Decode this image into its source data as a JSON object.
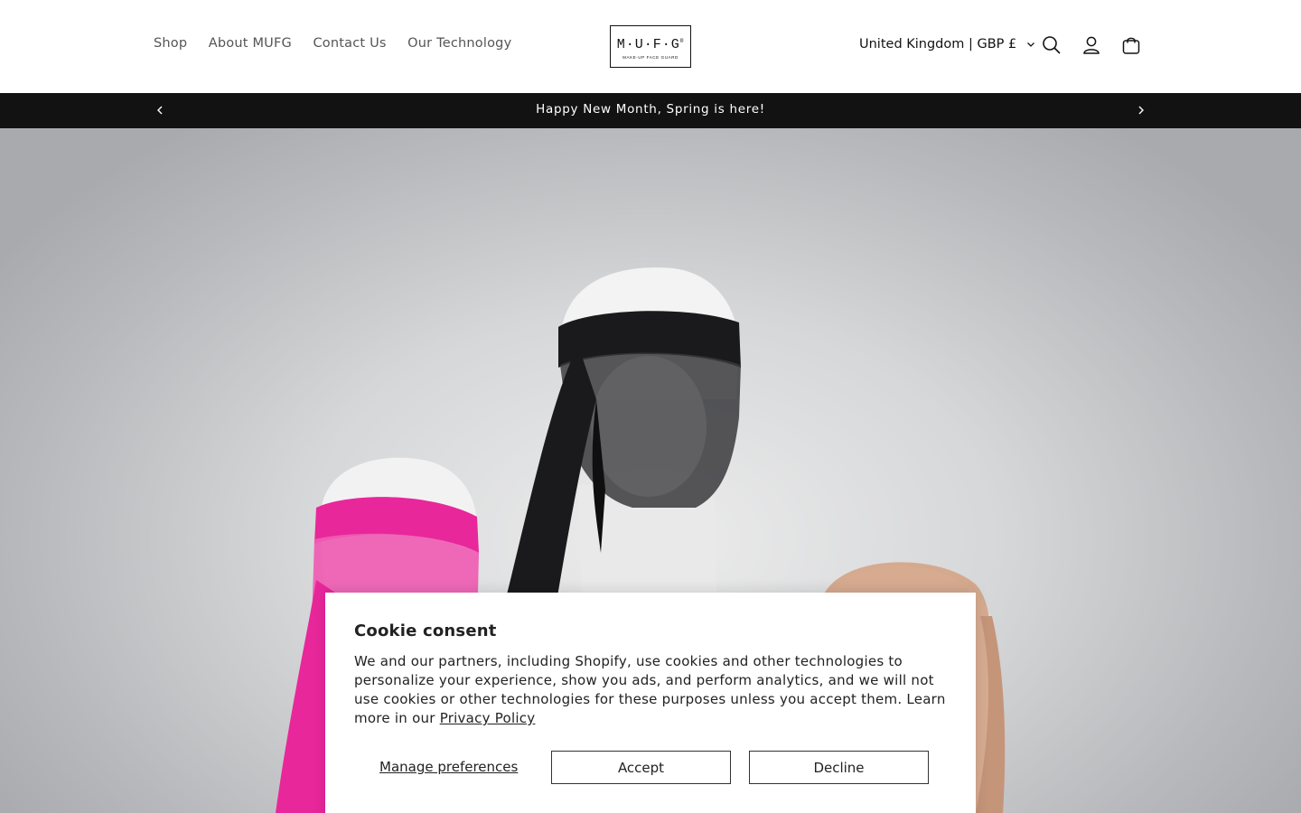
{
  "header": {
    "nav": [
      {
        "label": "Shop"
      },
      {
        "label": "About MUFG"
      },
      {
        "label": "Contact Us"
      },
      {
        "label": "Our Technology"
      }
    ],
    "logo": {
      "main": "M·U·F·G",
      "sub": "MAKE-UP FACE GUARD",
      "mark": "®"
    },
    "country_selector": "United Kingdom | GBP £",
    "icons": [
      "search-icon",
      "account-icon",
      "cart-icon"
    ]
  },
  "announcement": {
    "text": "Happy New Month, Spring is here!",
    "prev_icon": "chevron-left-icon",
    "next_icon": "chevron-right-icon"
  },
  "hero": {
    "colors": {
      "pink": "#e8279a",
      "black": "#1a1a1c",
      "nude": "#d4a68a",
      "background": "#d3d4d6"
    }
  },
  "cookie": {
    "title": "Cookie consent",
    "body": "We and our partners, including Shopify, use cookies and other technologies to personalize your experience, show you ads, and perform analytics, and we will not use cookies or other technologies for these purposes unless you accept them. Learn more in our ",
    "policy_link": "Privacy Policy",
    "manage_label": "Manage preferences",
    "accept_label": "Accept",
    "decline_label": "Decline"
  }
}
